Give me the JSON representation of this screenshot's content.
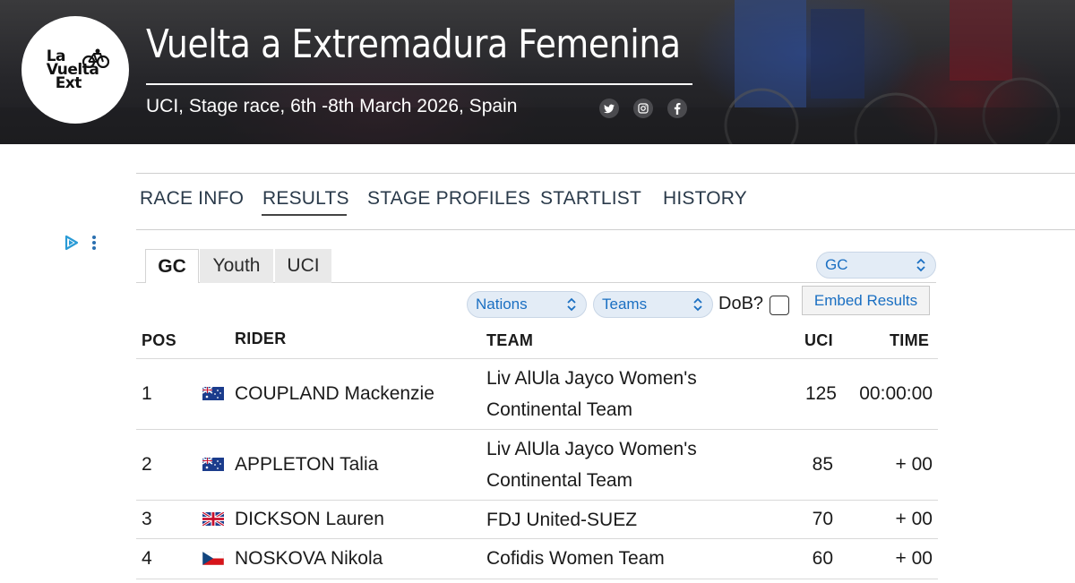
{
  "logo": {
    "line1": "La",
    "line2": "Vuelta",
    "line3": "Ext"
  },
  "header": {
    "title": "Vuelta a Extremadura Femenina",
    "subtitle": "UCI, Stage race, 6th -8th March 2026, Spain"
  },
  "social_icons": [
    "twitter-icon",
    "instagram-icon",
    "facebook-icon"
  ],
  "nav": {
    "items": [
      {
        "label": "RACE INFO"
      },
      {
        "label": "RESULTS"
      },
      {
        "label": "STAGE PROFILES"
      },
      {
        "label": "STARTLIST"
      },
      {
        "label": "HISTORY"
      }
    ],
    "active": "RESULTS"
  },
  "tabs": [
    {
      "label": "GC"
    },
    {
      "label": "Youth"
    },
    {
      "label": "UCI"
    }
  ],
  "active_tab": "GC",
  "filters": {
    "classification": "GC",
    "nations": "Nations",
    "teams": "Teams",
    "dob_label": "DoB?",
    "embed_label": "Embed Results"
  },
  "table": {
    "headers": {
      "pos": "POS",
      "rider": "RIDER",
      "team": "TEAM",
      "uci": "UCI",
      "time": "TIME"
    },
    "rows": [
      {
        "pos": "1",
        "flag": "AU",
        "rider": "COUPLAND Mackenzie",
        "team_line1": "Liv AlUla Jayco Women's",
        "team_line2": "Continental Team",
        "uci": "125",
        "time": "00:00:00"
      },
      {
        "pos": "2",
        "flag": "AU",
        "rider": "APPLETON Talia",
        "team_line1": "Liv AlUla Jayco Women's",
        "team_line2": "Continental Team",
        "uci": "85",
        "time": "+ 00"
      },
      {
        "pos": "3",
        "flag": "GB",
        "rider": "DICKSON Lauren",
        "team_line1": "FDJ United-SUEZ",
        "team_line2": "",
        "uci": "70",
        "time": "+ 00"
      },
      {
        "pos": "4",
        "flag": "CZ",
        "rider": "NOSKOVA Nikola",
        "team_line1": "Cofidis Women Team",
        "team_line2": "",
        "uci": "60",
        "time": "+ 00"
      }
    ]
  },
  "colors": {
    "link_blue": "#1a6fc2",
    "banner_dark": "#26262a"
  }
}
